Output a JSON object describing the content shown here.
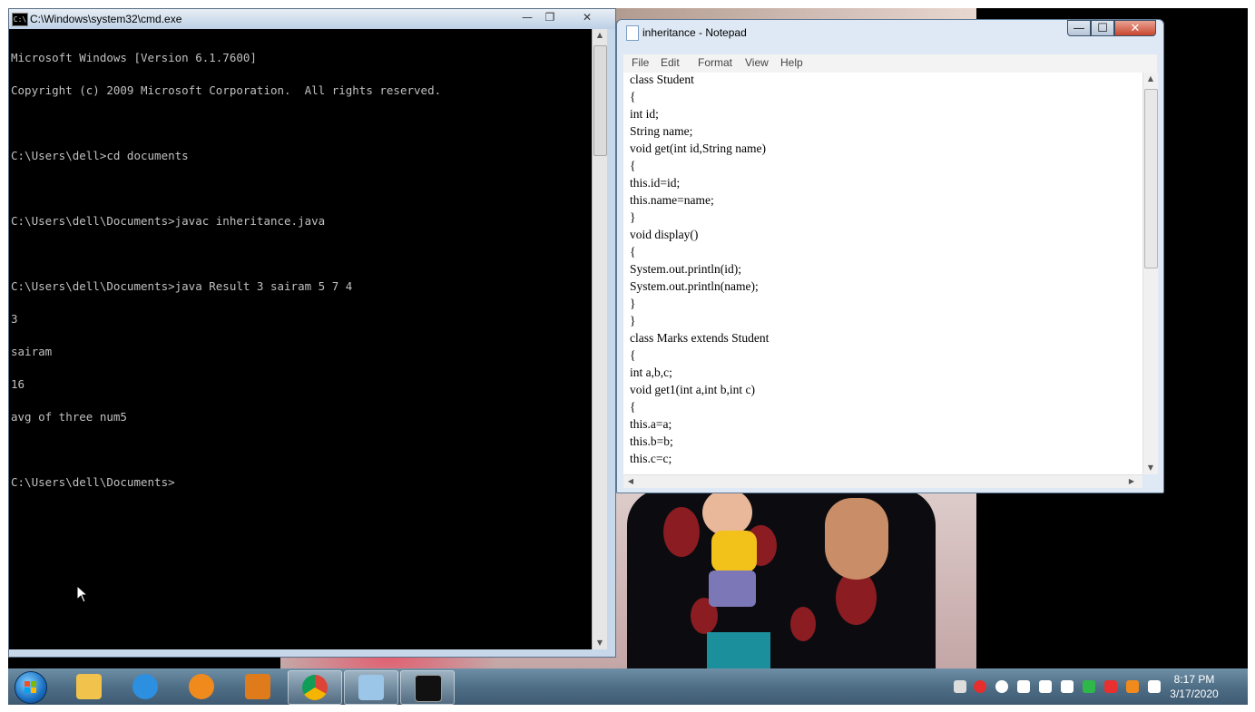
{
  "cmd": {
    "title": "C:\\Windows\\system32\\cmd.exe",
    "icon_text": "C:\\",
    "lines": [
      "Microsoft Windows [Version 6.1.7600]",
      "Copyright (c) 2009 Microsoft Corporation.  All rights reserved.",
      "",
      "C:\\Users\\dell>cd documents",
      "",
      "C:\\Users\\dell\\Documents>javac inheritance.java",
      "",
      "C:\\Users\\dell\\Documents>java Result 3 sairam 5 7 4",
      "3",
      "sairam",
      "16",
      "avg of three num5",
      "",
      "C:\\Users\\dell\\Documents>"
    ],
    "buttons": {
      "minimize": "—",
      "restore": "❐",
      "close": "✕"
    }
  },
  "notepad": {
    "title": "inheritance - Notepad",
    "buttons": {
      "minimize": "—",
      "maximize": "☐",
      "close": "✕"
    },
    "menu": [
      "File",
      "Edit",
      "Format",
      "View",
      "Help"
    ],
    "lines": [
      "class Student",
      "{",
      "int id;",
      "String name;",
      "void get(int id,String name)",
      "{",
      "this.id=id;",
      "this.name=name;",
      "}",
      "void display()",
      "{",
      "System.out.println(id);",
      "System.out.println(name);",
      "}",
      "}",
      "class Marks extends Student",
      "{",
      "int a,b,c;",
      "void get1(int a,int b,int c)",
      "{",
      "this.a=a;",
      "this.b=b;",
      "this.c=c;"
    ]
  },
  "taskbar": {
    "pinned": [
      {
        "name": "windows-explorer",
        "color": "#f1c24c"
      },
      {
        "name": "internet-explorer",
        "color": "#2d8fe0"
      },
      {
        "name": "app-orange",
        "color": "#f08a1c"
      },
      {
        "name": "media-player",
        "color": "#e07b1b"
      },
      {
        "name": "chrome",
        "color": "#3aa757"
      },
      {
        "name": "notepad",
        "color": "#9cc6e8"
      },
      {
        "name": "command-prompt",
        "color": "#111111"
      }
    ],
    "tray_colors": [
      "#dddddd",
      "#e62e2e",
      "#ffffff",
      "#ffffff",
      "#ffffff",
      "#ffffff",
      "#2eb84a",
      "#e83030",
      "#f08a1c",
      "#ffffff"
    ],
    "clock_time": "8:17 PM",
    "clock_date": "3/17/2020"
  }
}
